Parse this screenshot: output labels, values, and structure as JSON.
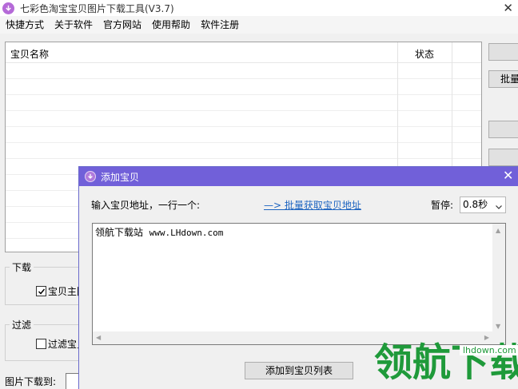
{
  "window": {
    "title": "七彩色淘宝宝贝图片下载工具(V3.7)",
    "close_glyph": "✕"
  },
  "menu": [
    "快捷方式",
    "关于软件",
    "官方网站",
    "使用帮助",
    "软件注册"
  ],
  "list": {
    "columns": [
      "宝贝名称",
      "状态"
    ]
  },
  "right_buttons": [
    "",
    "批量",
    "",
    ""
  ],
  "groups": {
    "download": {
      "legend": "下载",
      "checkbox_label": "宝贝主图",
      "checked": true
    },
    "filter": {
      "legend": "过滤",
      "checkbox_label": "过滤宝贝",
      "checked": false
    }
  },
  "download_to_label": "图片下载到:",
  "dialog": {
    "title": "添加宝贝",
    "close_glyph": "✕",
    "prompt": "输入宝贝地址，一行一个:",
    "batch_link": "—> 批量获取宝贝地址",
    "pause_label": "暂停:",
    "pause_value": "0.8秒",
    "textarea_value_prefix": "领航下载站  ",
    "textarea_value_url": "www.LHdown.com",
    "add_button": "添加到宝贝列表"
  },
  "watermark": {
    "text": "领航下载",
    "site": "lhdown.com"
  },
  "colors": {
    "dialog_title_bg": "#7160d9",
    "link": "#1d64c0",
    "watermark": "#1f9a3a"
  }
}
